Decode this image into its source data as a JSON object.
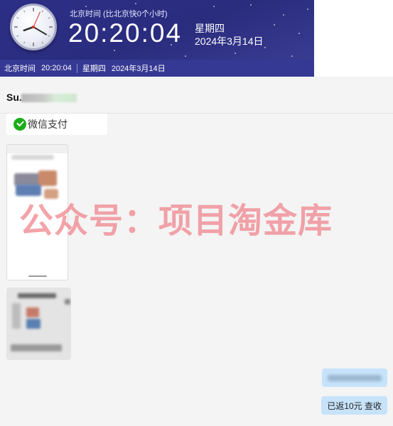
{
  "clock_widget": {
    "timezone_label": "北京时间 (比北京快0个小时)",
    "time": "20:20:04",
    "weekday": "星期四",
    "date": "2024年3月14日",
    "analog": {
      "hour": 20,
      "minute": 20,
      "second": 4
    }
  },
  "status_bar": {
    "label": "北京时间",
    "time": "20:20:04",
    "weekday": "星期四",
    "date": "2024年3月14日"
  },
  "chat": {
    "contact_name_visible": "Su.",
    "messages": {
      "wechat_pay_label": "微信支付",
      "refund_message": "已返10元 查收"
    }
  },
  "watermark": "公众号：项目淘金库",
  "colors": {
    "clock_bg": "#2c2f86",
    "status_bg": "#363993",
    "chat_bg": "#f4f4f4",
    "outgoing_bubble": "#c6e3fa",
    "wechat_green": "#1aad19",
    "watermark": "#f08a92"
  },
  "icons": [
    "analog-clock-icon",
    "wechat-pay-icon"
  ]
}
